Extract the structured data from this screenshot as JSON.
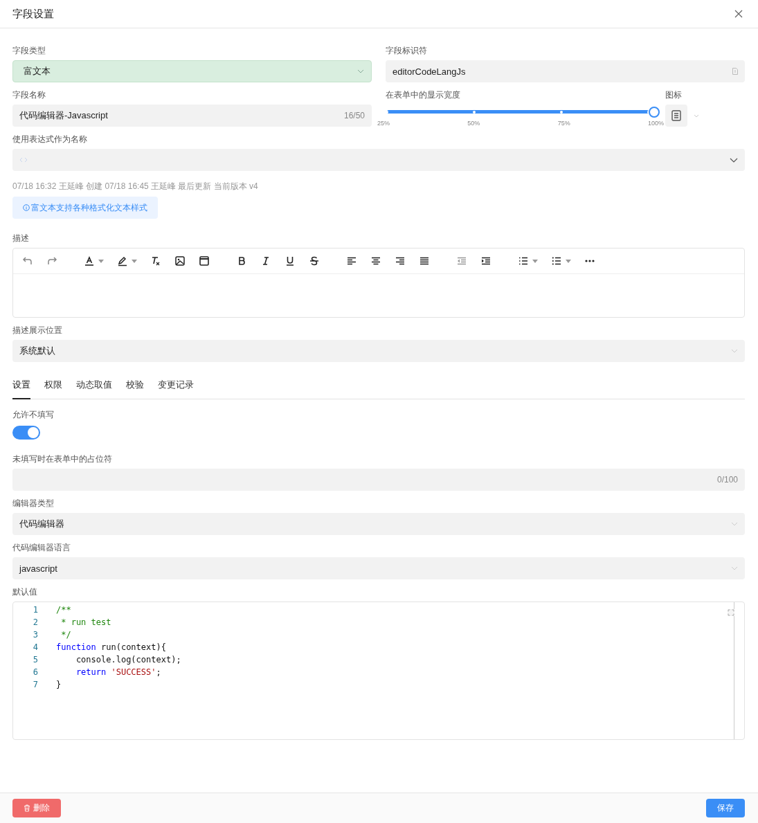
{
  "dialog": {
    "title": "字段设置"
  },
  "field_type": {
    "label": "字段类型",
    "value": "富文本"
  },
  "field_key": {
    "label": "字段标识符",
    "value": "editorCodeLangJs"
  },
  "field_name": {
    "label": "字段名称",
    "value": "代码编辑器-Javascript",
    "counter": "16/50"
  },
  "display_width": {
    "label": "在表单中的显示宽度",
    "level": 1,
    "ticks": [
      "25%",
      "50%",
      "75%",
      "100%"
    ]
  },
  "icon_picker": {
    "label": "图标"
  },
  "expression_name": {
    "label": "使用表达式作为名称"
  },
  "meta": "07/18 16:32 王延峰 创建 07/18 16:45 王延峰 最后更新 当前版本 v4",
  "info_tip": "富文本支持各种格式化文本样式",
  "description": {
    "label": "描述"
  },
  "description_position": {
    "label": "描述展示位置",
    "value": "系统默认"
  },
  "tabs": [
    {
      "label": "设置",
      "selected": true
    },
    {
      "label": "权限",
      "selected": false
    },
    {
      "label": "动态取值",
      "selected": false
    },
    {
      "label": "校验",
      "selected": false
    },
    {
      "label": "变更记录",
      "selected": false
    }
  ],
  "allow_empty": {
    "label": "允许不填写",
    "on": true
  },
  "placeholder_setting": {
    "label": "未填写时在表单中的占位符",
    "counter": "0/100"
  },
  "editor_type": {
    "label": "编辑器类型",
    "value": "代码编辑器"
  },
  "code_language": {
    "label": "代码编辑器语言",
    "value": "javascript"
  },
  "default_value": {
    "label": "默认值",
    "lines": [
      {
        "number": "1",
        "indent": false,
        "tokens": [
          {
            "kind": "comment",
            "text": "/**"
          }
        ]
      },
      {
        "number": "2",
        "indent": false,
        "tokens": [
          {
            "kind": "comment",
            "text": " * run test"
          }
        ]
      },
      {
        "number": "3",
        "indent": false,
        "tokens": [
          {
            "kind": "comment",
            "text": " */"
          }
        ]
      },
      {
        "number": "4",
        "indent": false,
        "tokens": [
          {
            "kind": "keyword",
            "text": "function"
          },
          {
            "kind": "plain",
            "text": " run(context){"
          }
        ]
      },
      {
        "number": "5",
        "indent": true,
        "tokens": [
          {
            "kind": "plain",
            "text": "console.log(context);"
          }
        ]
      },
      {
        "number": "6",
        "indent": true,
        "tokens": [
          {
            "kind": "keyword",
            "text": "return"
          },
          {
            "kind": "string",
            "text": " 'SUCCESS'"
          },
          {
            "kind": "plain",
            "text": ";"
          }
        ]
      },
      {
        "number": "7",
        "indent": false,
        "tokens": [
          {
            "kind": "plain",
            "text": "}"
          }
        ]
      }
    ]
  },
  "footer": {
    "delete": "删除",
    "save": "保存"
  }
}
